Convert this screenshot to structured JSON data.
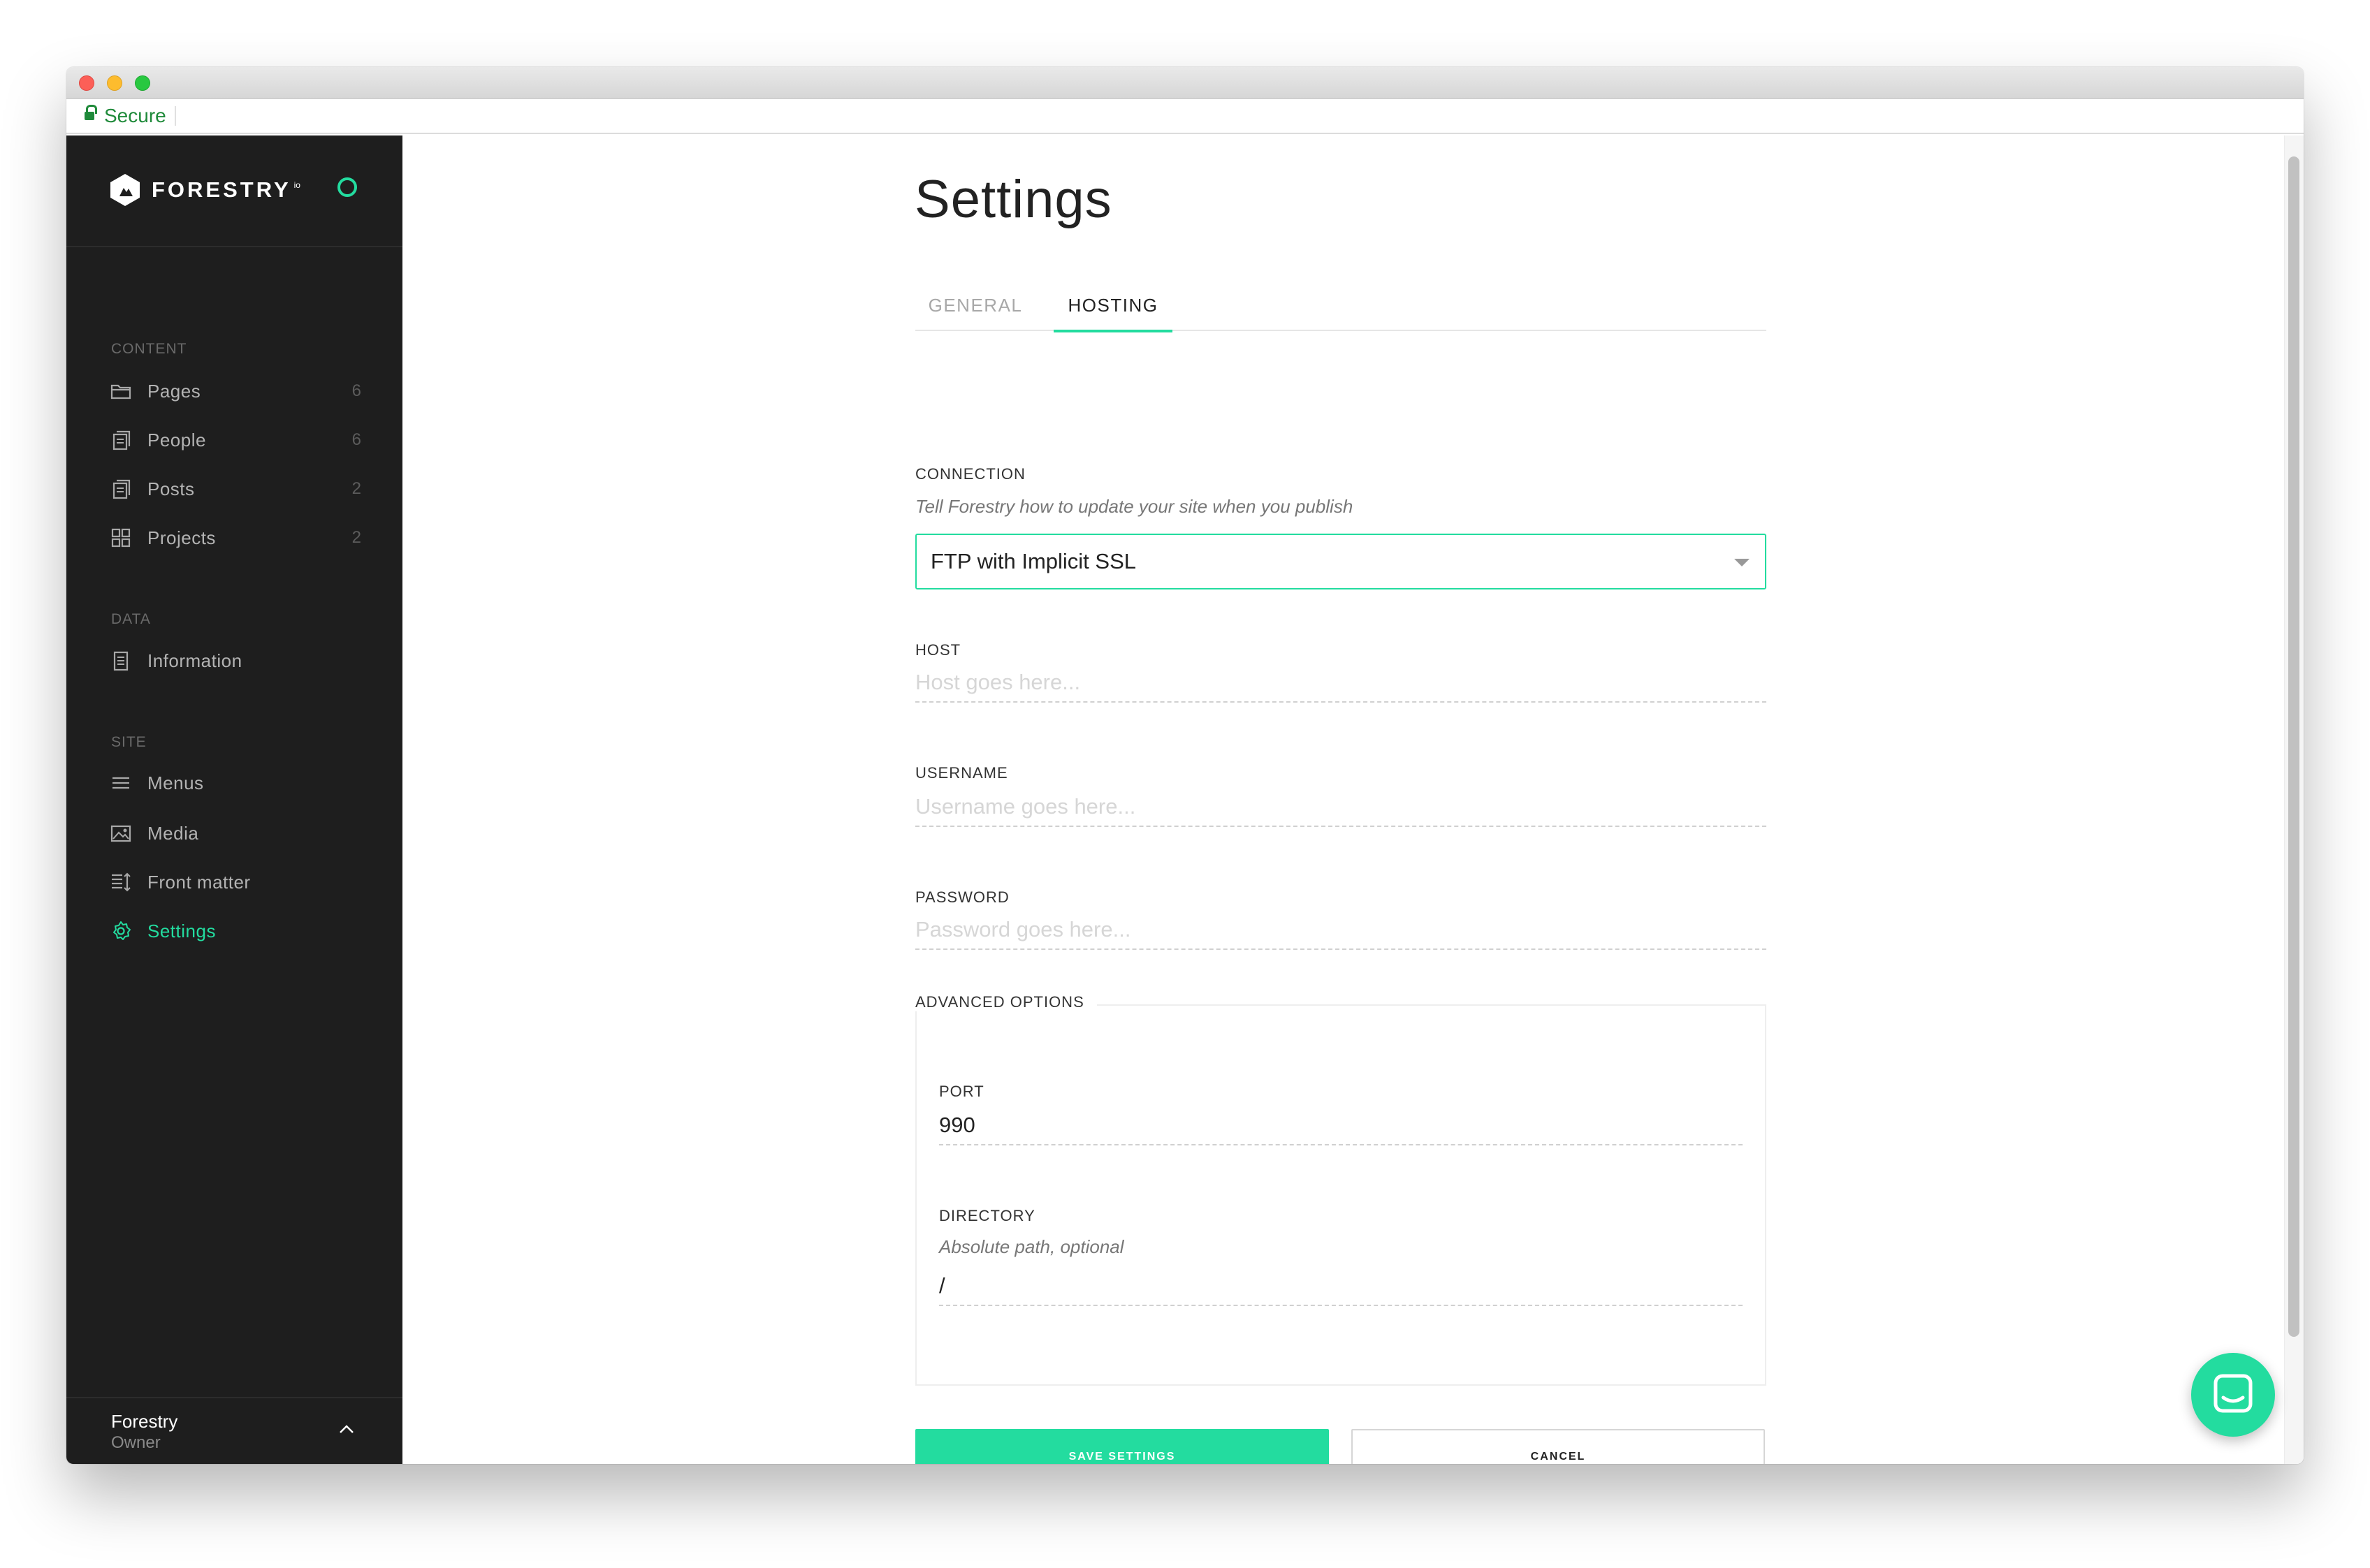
{
  "browser": {
    "secure_label": "Secure"
  },
  "sidebar": {
    "brand_name": "FORESTRY",
    "brand_sup": "io",
    "sections": [
      {
        "label": "CONTENT",
        "items": [
          {
            "label": "Pages",
            "count": "6",
            "icon": "folder-icon"
          },
          {
            "label": "People",
            "count": "6",
            "icon": "documents-icon"
          },
          {
            "label": "Posts",
            "count": "2",
            "icon": "documents-icon"
          },
          {
            "label": "Projects",
            "count": "2",
            "icon": "grid-icon"
          }
        ]
      },
      {
        "label": "DATA",
        "items": [
          {
            "label": "Information",
            "icon": "document-icon"
          }
        ]
      },
      {
        "label": "SITE",
        "items": [
          {
            "label": "Menus",
            "icon": "menu-icon"
          },
          {
            "label": "Media",
            "icon": "image-icon"
          },
          {
            "label": "Front matter",
            "icon": "front-matter-icon"
          },
          {
            "label": "Settings",
            "icon": "gear-icon",
            "active": true
          }
        ]
      }
    ],
    "footer": {
      "name": "Forestry",
      "role": "Owner"
    }
  },
  "main": {
    "title": "Settings",
    "tabs": [
      {
        "label": "GENERAL",
        "active": false
      },
      {
        "label": "HOSTING",
        "active": true
      }
    ],
    "connection": {
      "label": "CONNECTION",
      "help": "Tell Forestry how to update your site when you publish",
      "value": "FTP with Implicit SSL"
    },
    "host": {
      "label": "HOST",
      "placeholder": "Host goes here...",
      "value": ""
    },
    "username": {
      "label": "USERNAME",
      "placeholder": "Username goes here...",
      "value": ""
    },
    "password": {
      "label": "PASSWORD",
      "placeholder": "Password goes here...",
      "value": ""
    },
    "advanced": {
      "label": "ADVANCED OPTIONS",
      "port": {
        "label": "PORT",
        "value": "990"
      },
      "directory": {
        "label": "DIRECTORY",
        "help": "Absolute path, optional",
        "value": "/"
      }
    },
    "buttons": {
      "save": "SAVE SETTINGS",
      "cancel": "CANCEL"
    }
  },
  "colors": {
    "accent": "#23dc9f",
    "sidebar_bg": "#1e1e1e",
    "secure_green": "#1f8a3a"
  }
}
